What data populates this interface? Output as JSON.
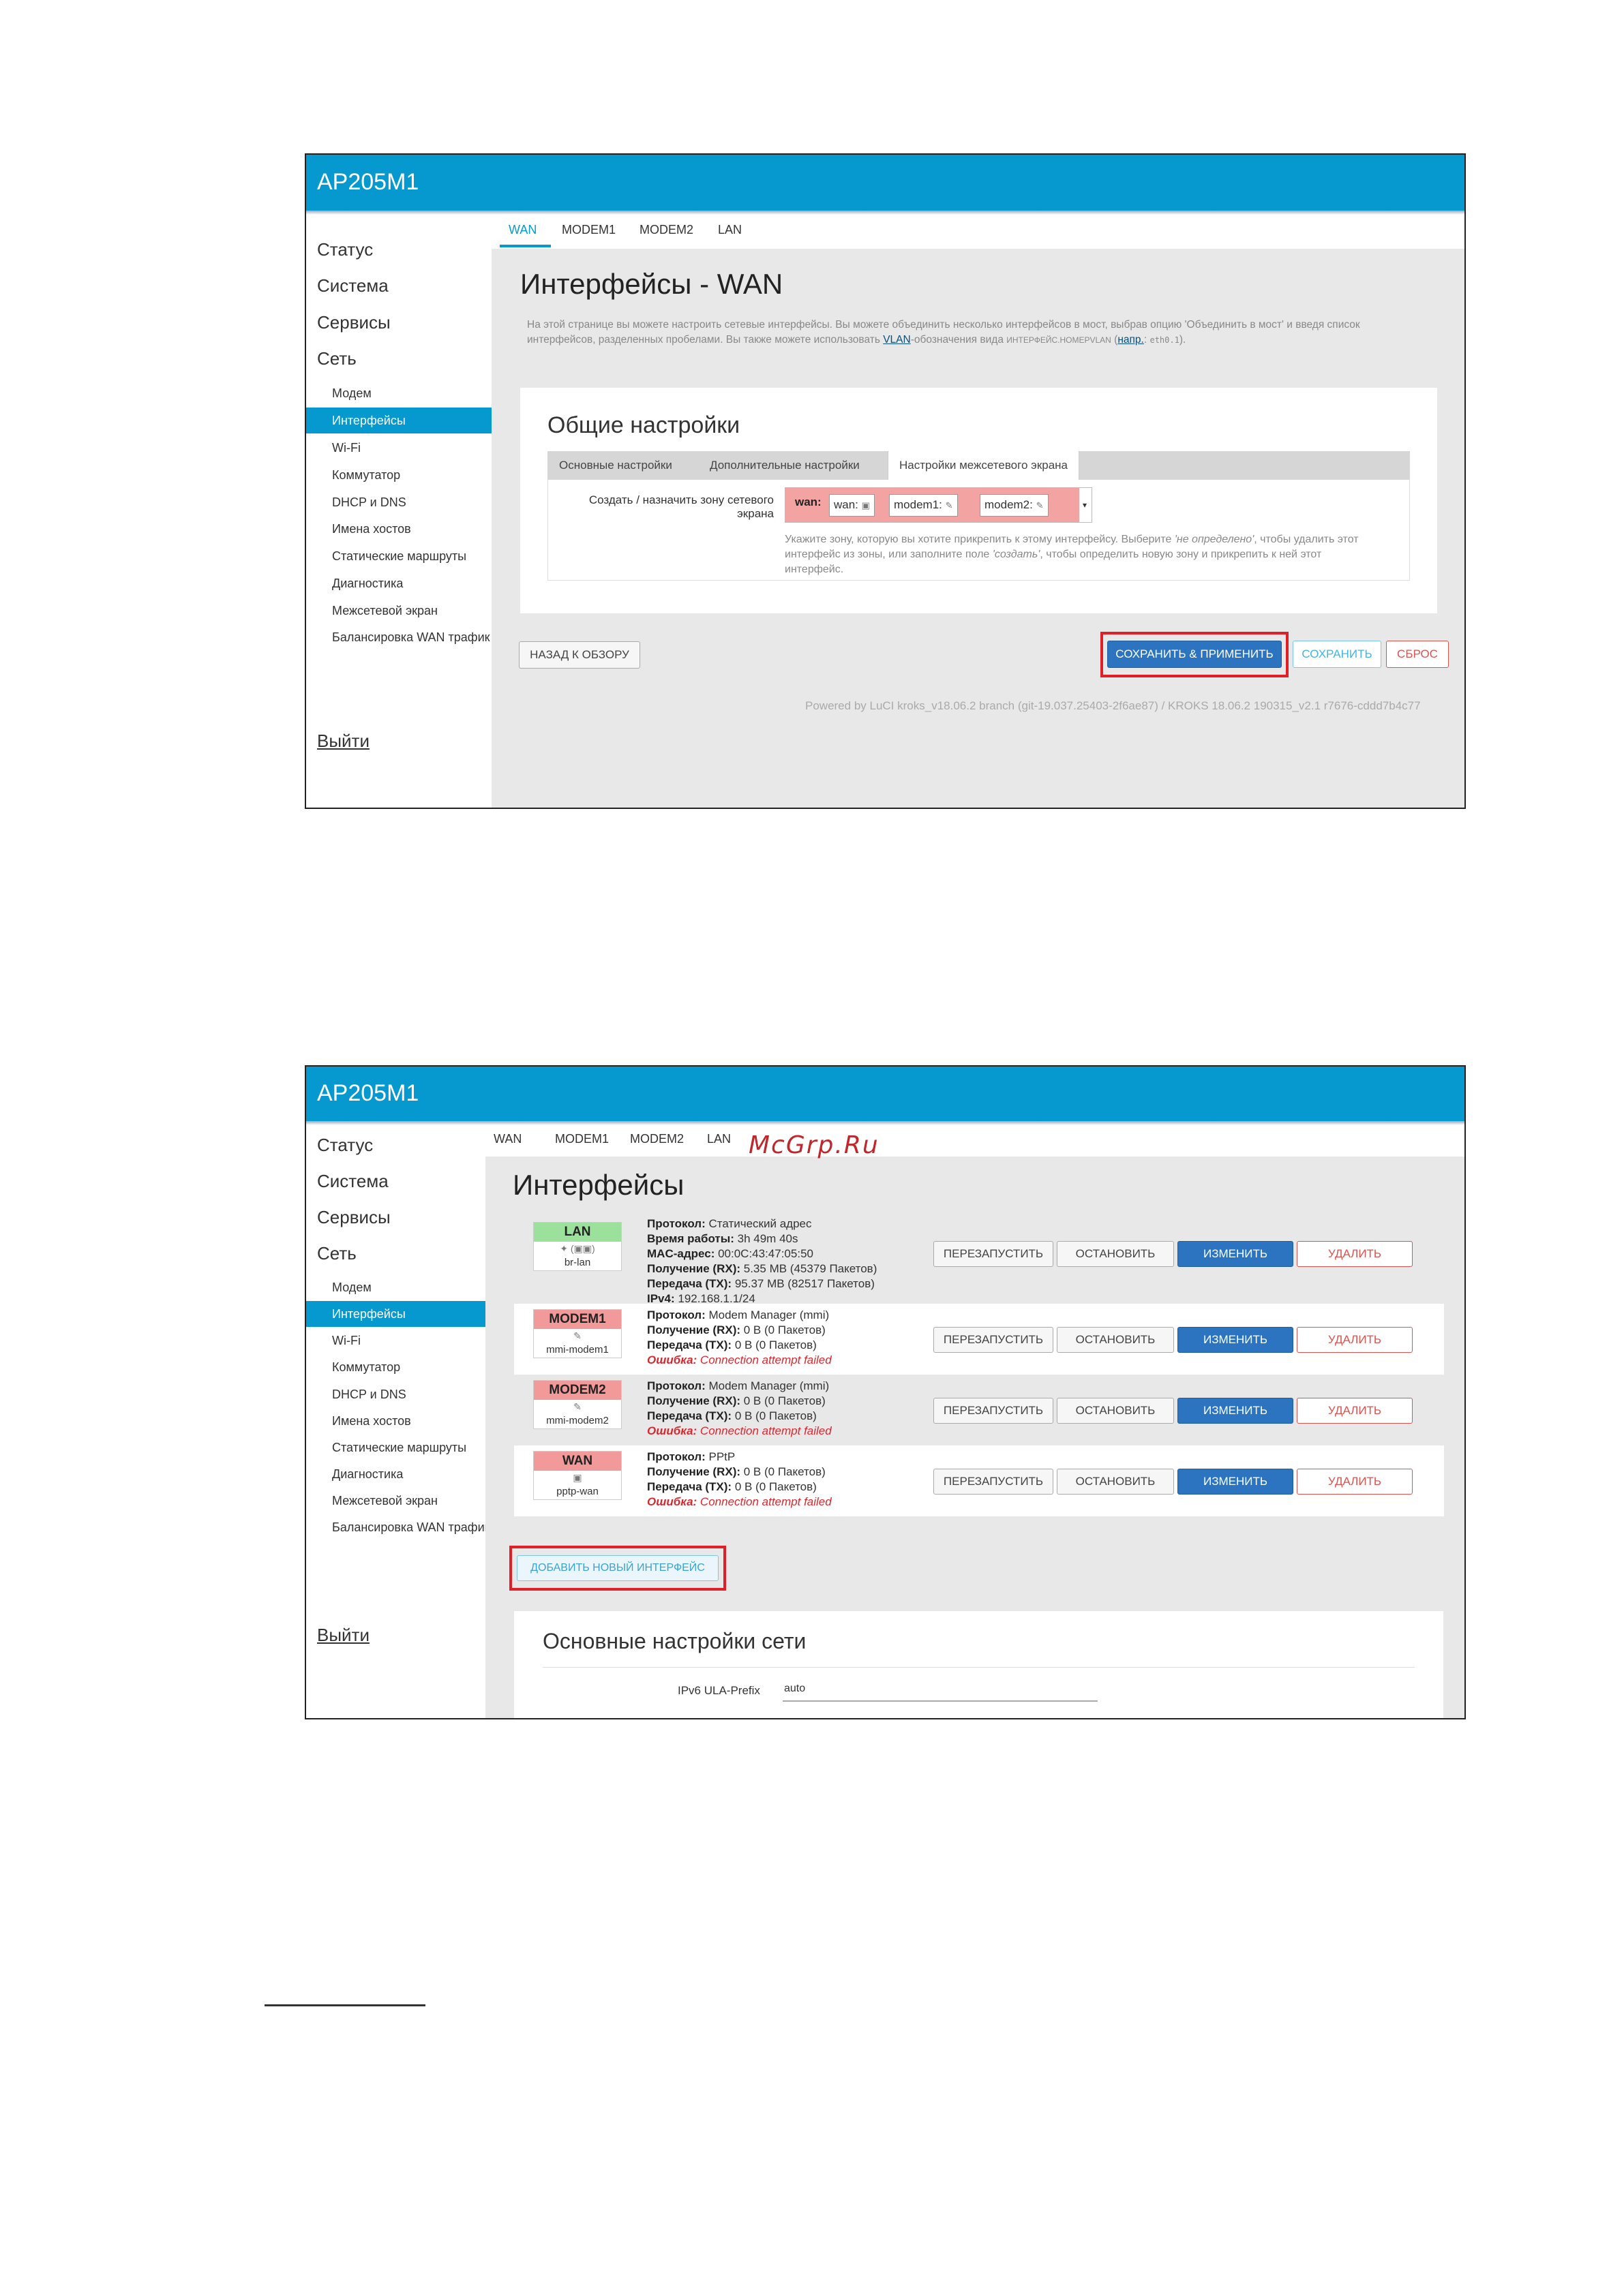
{
  "watermark": "McGrp.Ru",
  "screenshot1": {
    "app_title": "AP205M1",
    "sidebar": {
      "top_items": [
        "Статус",
        "Система",
        "Сервисы",
        "Сеть"
      ],
      "sub_items": [
        "Модем",
        "Интерфейсы",
        "Wi-Fi",
        "Коммутатор",
        "DHCP и DNS",
        "Имена хостов",
        "Статические маршруты",
        "Диагностика",
        "Межсетевой экран",
        "Балансировка WAN трафик"
      ],
      "active_item": "Интерфейсы",
      "logout": "Выйти"
    },
    "tabs": [
      "WAN",
      "MODEM1",
      "MODEM2",
      "LAN"
    ],
    "active_tab": "WAN",
    "page_title": "Интерфейсы - WAN",
    "description": {
      "part1": "На этой странице вы можете настроить сетевые интерфейсы. Вы можете объединить несколько интерфейсов в мост, выбрав опцию 'Объединить в мост' и введя список интерфейсов, разделенных пробелами. Вы также можете использовать ",
      "link": "VLAN",
      "part2": "-обозначения вида ",
      "small": "ИНТЕРФЕЙС.НОМЕРVLAN",
      "part3": " (",
      "link2": "напр.",
      "part4": ": ",
      "mono": "eth0.1",
      "part5": ")."
    },
    "panel": {
      "title": "Общие настройки",
      "subtabs": [
        "Основные настройки",
        "Дополнительные настройки",
        "Настройки межсетевого экрана"
      ],
      "active_subtab": "Настройки межсетевого экрана",
      "field_label": "Создать / назначить зону сетевого экрана",
      "zone": {
        "label": "wan:",
        "chips": [
          "wan:",
          "modem1:",
          "modem2:"
        ]
      },
      "hint": {
        "part1": "Укажите зону, которую вы хотите прикрепить к этому интерфейсу. Выберите ",
        "undefined": "'не определено'",
        "part2": ", чтобы удалить этот интерфейс из зоны, или заполните поле ",
        "create": "'создать'",
        "part3": ", чтобы определить новую зону и прикрепить к ней этот интерфейс."
      }
    },
    "buttons": {
      "back": "НАЗАД К ОБЗОРУ",
      "save_apply": "СОХРАНИТЬ & ПРИМЕНИТЬ",
      "save": "СОХРАНИТЬ",
      "reset": "СБРОС"
    },
    "footer": "Powered by LuCI kroks_v18.06.2 branch (git-19.037.25403-2f6ae87) / KROKS 18.06.2 190315_v2.1 r7676-cddd7b4c77"
  },
  "screenshot2": {
    "app_title": "AP205M1",
    "sidebar": {
      "top_items": [
        "Статус",
        "Система",
        "Сервисы",
        "Сеть"
      ],
      "sub_items": [
        "Модем",
        "Интерфейсы",
        "Wi-Fi",
        "Коммутатор",
        "DHCP и DNS",
        "Имена хостов",
        "Статические маршруты",
        "Диагностика",
        "Межсетевой экран",
        "Балансировка WAN трафик"
      ],
      "active_item": "Интерфейсы",
      "logout": "Выйти"
    },
    "tabs": [
      "WAN",
      "MODEM1",
      "MODEM2",
      "LAN"
    ],
    "page_title": "Интерфейсы",
    "interfaces": [
      {
        "name": "LAN",
        "badge_color": "#9be09b",
        "device": "br-lan",
        "lines": [
          {
            "label": "Протокол:",
            "value": " Статический адрес",
            "error": false
          },
          {
            "label": "Время работы:",
            "value": " 3h 49m 40s",
            "error": false
          },
          {
            "label": "MAC-адрес:",
            "value": " 00:0C:43:47:05:50",
            "error": false
          },
          {
            "label": "Получение (RX):",
            "value": " 5.35 MB (45379 Пакетов)",
            "error": false
          },
          {
            "label": "Передача (TX):",
            "value": " 95.37 MB (82517 Пакетов)",
            "error": false
          },
          {
            "label": "IPv4:",
            "value": " 192.168.1.1/24",
            "error": false
          }
        ]
      },
      {
        "name": "MODEM1",
        "badge_color": "#f29a9a",
        "device": "mmi-modem1",
        "lines": [
          {
            "label": "Протокол:",
            "value": " Modem Manager (mmi)",
            "error": false
          },
          {
            "label": "Получение (RX):",
            "value": " 0 B (0 Пакетов)",
            "error": false
          },
          {
            "label": "Передача (TX):",
            "value": " 0 B (0 Пакетов)",
            "error": false
          },
          {
            "label": "Ошибка:",
            "value": " Connection attempt failed",
            "error": true
          }
        ]
      },
      {
        "name": "MODEM2",
        "badge_color": "#f29a9a",
        "device": "mmi-modem2",
        "lines": [
          {
            "label": "Протокол:",
            "value": " Modem Manager (mmi)",
            "error": false
          },
          {
            "label": "Получение (RX):",
            "value": " 0 B (0 Пакетов)",
            "error": false
          },
          {
            "label": "Передача (TX):",
            "value": " 0 B (0 Пакетов)",
            "error": false
          },
          {
            "label": "Ошибка:",
            "value": " Connection attempt failed",
            "error": true
          }
        ]
      },
      {
        "name": "WAN",
        "badge_color": "#f29a9a",
        "device": "pptp-wan",
        "lines": [
          {
            "label": "Протокол:",
            "value": " PPtP",
            "error": false
          },
          {
            "label": "Получение (RX):",
            "value": " 0 B (0 Пакетов)",
            "error": false
          },
          {
            "label": "Передача (TX):",
            "value": " 0 B (0 Пакетов)",
            "error": false
          },
          {
            "label": "Ошибка:",
            "value": " Connection attempt failed",
            "error": true
          }
        ]
      }
    ],
    "row_buttons": {
      "restart": "ПЕРЕЗАПУСТИТЬ",
      "stop": "ОСТАНОВИТЬ",
      "edit": "ИЗМЕНИТЬ",
      "delete": "УДАЛИТЬ"
    },
    "add_interface": "ДОБАВИТЬ НОВЫЙ ИНТЕРФЕЙС",
    "global_section": {
      "title": "Основные настройки сети",
      "ula_label": "IPv6 ULA-Prefix",
      "ula_value": "auto"
    }
  }
}
